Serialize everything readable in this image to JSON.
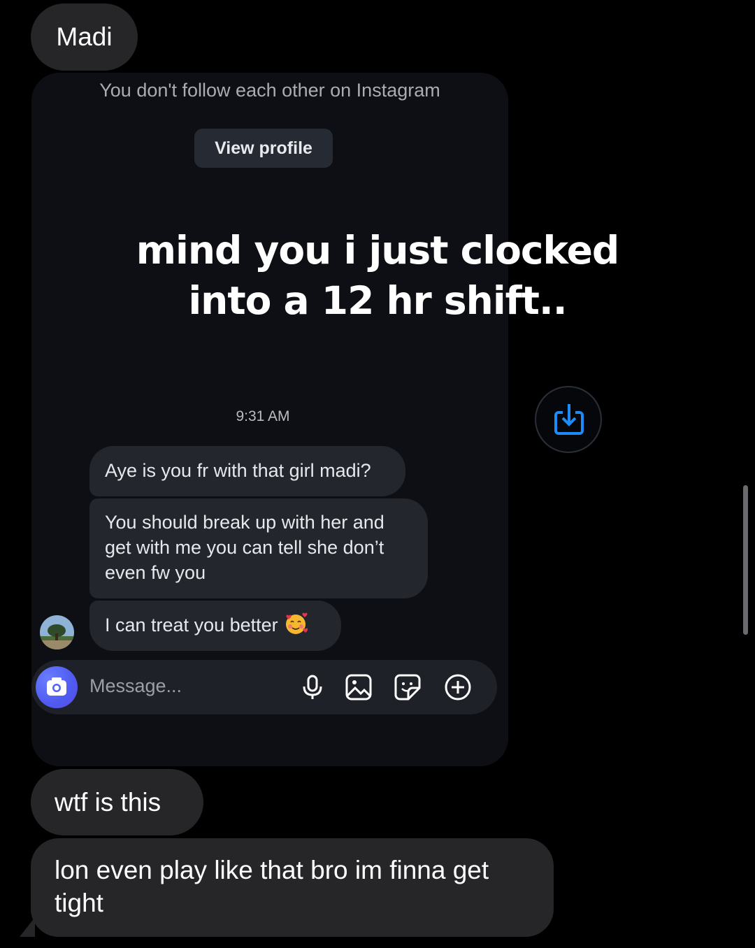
{
  "chat": {
    "sender_name": "Madi",
    "messages_after": [
      {
        "text": "wtf is this"
      },
      {
        "text": "lon even play like that bro im finna get tight"
      }
    ]
  },
  "shared_screenshot": {
    "follow_note": "You don't follow each other on Instagram",
    "view_profile_label": "View profile",
    "timestamp": "9:31 AM",
    "messages": [
      {
        "text": "Aye is you fr with that girl madi?"
      },
      {
        "text": "You should break up with her and get with me you can tell she don’t even fw you"
      },
      {
        "text": "I can treat you better"
      }
    ],
    "composer": {
      "placeholder": "Message...",
      "icons": [
        "camera-icon",
        "microphone-icon",
        "gallery-icon",
        "sticker-icon",
        "plus-icon"
      ]
    }
  },
  "overlay": {
    "caption_line1": "mind you i just clocked",
    "caption_line2": "into a 12 hr shift.."
  },
  "colors": {
    "background": "#000000",
    "bubble": "#262629",
    "card_background": "#0d0f14",
    "accent_blue": "#1d8cf8",
    "camera_gradient": "#4f5bf0"
  }
}
